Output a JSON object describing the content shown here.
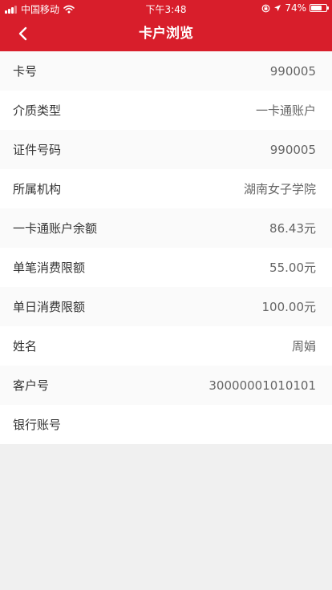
{
  "status_bar": {
    "carrier": "中国移动",
    "time": "下午3:48",
    "battery_text": "74%",
    "battery_level": 0.74,
    "icons": [
      "signal-icon",
      "wifi-icon",
      "orientation-lock-icon",
      "location-icon",
      "battery-icon"
    ]
  },
  "nav": {
    "title": "卡户浏览",
    "back_icon": "chevron-left-icon",
    "accent_color": "#d81e2b"
  },
  "rows": [
    {
      "label": "卡号",
      "value": "990005"
    },
    {
      "label": "介质类型",
      "value": "一卡通账户"
    },
    {
      "label": "证件号码",
      "value": "990005"
    },
    {
      "label": "所属机构",
      "value": "湖南女子学院"
    },
    {
      "label": "一卡通账户余额",
      "value": "86.43元"
    },
    {
      "label": "单笔消费限额",
      "value": "55.00元"
    },
    {
      "label": "单日消费限额",
      "value": "100.00元"
    },
    {
      "label": "姓名",
      "value": "周娟"
    },
    {
      "label": "客户号",
      "value": "30000001010101"
    },
    {
      "label": "银行账号",
      "value": ""
    }
  ]
}
